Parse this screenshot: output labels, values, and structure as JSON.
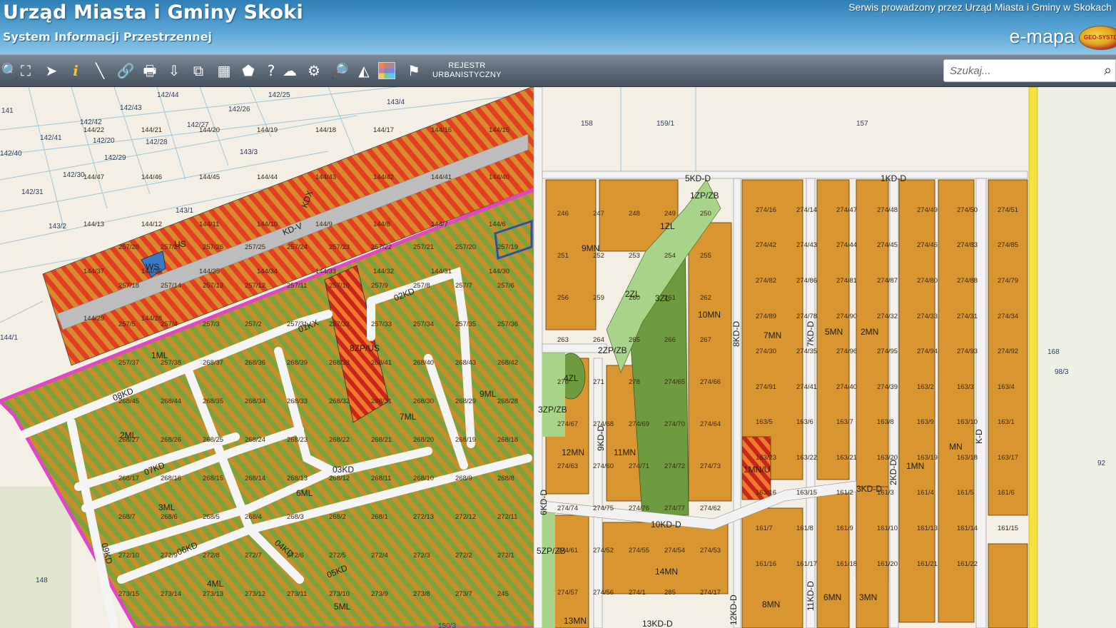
{
  "header": {
    "title": "Urząd Miasta i Gminy Skoki",
    "subtitle": "System Informacji Przestrzennej",
    "service_text": "Serwis prowadzony przez Urząd Miasta i Gminy w Skokach",
    "brand": "e-mapa",
    "logo_text": "GEO-SYSTEM"
  },
  "toolbar": {
    "tools": [
      {
        "icon": "zoom-in-icon",
        "glyph": "🔍"
      },
      {
        "icon": "zoom-extent-icon",
        "glyph": "⛶"
      },
      {
        "icon": "select-arrow-icon",
        "glyph": "➤"
      },
      {
        "icon": "info-icon",
        "glyph": "i"
      },
      {
        "icon": "measure-icon",
        "glyph": "╲"
      },
      {
        "icon": "link-icon",
        "glyph": "🔗"
      },
      {
        "icon": "print-icon",
        "glyph": "🖶"
      },
      {
        "icon": "download-icon",
        "glyph": "⇩"
      },
      {
        "icon": "copy-icon",
        "glyph": "⧉"
      },
      {
        "icon": "layout-icon",
        "glyph": "▦"
      },
      {
        "icon": "map-icon",
        "glyph": "⬟"
      },
      {
        "icon": "help-icon",
        "glyph": "?"
      },
      {
        "icon": "cloud-icon",
        "glyph": "☁"
      },
      {
        "icon": "settings-icon",
        "glyph": "⚙"
      },
      {
        "icon": "search-map-icon",
        "glyph": "🔎"
      },
      {
        "icon": "triangle-icon",
        "glyph": "◭"
      },
      {
        "icon": "layers-grid-icon",
        "glyph": ""
      },
      {
        "icon": "legend-icon",
        "glyph": "⚑"
      }
    ],
    "rejestr_line1": "REJESTR",
    "rejestr_line2": "URBANISTYCZNY"
  },
  "search": {
    "placeholder": "Szukaj..."
  },
  "colors": {
    "header": "#4a98cc",
    "toolbar": "#5d6b78",
    "residential": "#d9952f",
    "green_zone": "#7fa84b",
    "hatch_red": "#e24b2a",
    "plan_border": "#e246c4",
    "road": "#f1f1f1",
    "yellow_road": "#f5e23c"
  },
  "map": {
    "zone_labels": [
      "1ML",
      "2ML",
      "3ML",
      "4ML",
      "5ML",
      "6ML",
      "7ML",
      "9ML",
      "8ZP/US",
      "US",
      "WS",
      "9MN",
      "7MN",
      "5MN",
      "2MN",
      "10MN",
      "11MN",
      "12MN",
      "13MN",
      "14MN",
      "6MN",
      "3MN",
      "8MN",
      "1MN",
      "MN",
      "1MN/U",
      "1ZL",
      "2ZL",
      "3ZL",
      "4ZL",
      "1ZP/ZB",
      "2ZP/ZB",
      "3ZP/ZB",
      "5ZP/ZB"
    ],
    "road_labels": [
      "KD-V",
      "KDX",
      "1KD-D",
      "5KD-D",
      "10KD-D",
      "3KD-D",
      "9KD-D",
      "8KD-D",
      "7KD-D",
      "11KD-D",
      "12KD-D",
      "2KD-D",
      "K-D",
      "6KD-D",
      "13KD-D",
      "02KD",
      "03KD",
      "04KD",
      "05KD",
      "06KD",
      "07KD",
      "08KD",
      "09KD",
      "01KX"
    ],
    "parcel_labels": [
      "141",
      "142/44",
      "142/25",
      "142/43",
      "142/26",
      "142/42",
      "142/27",
      "142/41",
      "142/20",
      "142/28",
      "142/40",
      "142/29",
      "143/3",
      "143/4",
      "142/30",
      "142/31",
      "143/1",
      "143/2",
      "144/1",
      "158",
      "159/1",
      "157",
      "98/3",
      "168",
      "92",
      "148",
      "150/3"
    ],
    "plot_labels": [
      "144/22",
      "144/21",
      "144/20",
      "144/19",
      "144/18",
      "144/17",
      "144/16",
      "144/15",
      "144/47",
      "144/46",
      "144/45",
      "144/44",
      "144/43",
      "144/42",
      "144/41",
      "144/40",
      "144/13",
      "144/12",
      "144/11",
      "144/10",
      "144/9",
      "144/8",
      "144/7",
      "144/6",
      "144/37",
      "144/36",
      "144/35",
      "144/34",
      "144/33",
      "144/32",
      "144/31",
      "144/30",
      "144/29",
      "144/28",
      "257/28",
      "257/27",
      "257/26",
      "257/25",
      "257/24",
      "257/23",
      "257/22",
      "257/21",
      "257/20",
      "257/19",
      "257/18",
      "257/14",
      "257/13",
      "257/12",
      "257/11",
      "257/10",
      "257/9",
      "257/8",
      "257/7",
      "257/6",
      "257/5",
      "257/4",
      "257/3",
      "257/2",
      "257/31",
      "257/32",
      "257/33",
      "257/34",
      "257/35",
      "257/36",
      "257/37",
      "257/38",
      "268/37",
      "268/36",
      "268/39",
      "268/38",
      "268/41",
      "268/40",
      "268/43",
      "268/42",
      "268/45",
      "268/44",
      "268/35",
      "268/34",
      "268/33",
      "268/32",
      "268/31",
      "268/30",
      "268/29",
      "268/28",
      "268/27",
      "268/26",
      "268/25",
      "268/24",
      "268/23",
      "268/22",
      "268/21",
      "268/20",
      "268/19",
      "268/18",
      "268/17",
      "268/16",
      "268/15",
      "268/14",
      "268/13",
      "268/12",
      "268/11",
      "268/10",
      "268/9",
      "268/8",
      "268/7",
      "268/6",
      "268/5",
      "268/4",
      "268/3",
      "268/2",
      "268/1",
      "272/13",
      "272/12",
      "272/11",
      "272/10",
      "272/9",
      "272/8",
      "272/7",
      "272/6",
      "272/5",
      "272/4",
      "272/3",
      "272/2",
      "272/1",
      "273/15",
      "273/14",
      "273/13",
      "273/12",
      "273/11",
      "273/10",
      "273/9",
      "273/8",
      "273/7",
      "245",
      "246",
      "247",
      "248",
      "249",
      "250",
      "251",
      "252",
      "253",
      "254",
      "255",
      "256",
      "259",
      "260",
      "261",
      "262",
      "263",
      "264",
      "265",
      "266",
      "267",
      "270",
      "271",
      "278",
      "274/65",
      "274/66",
      "274/67",
      "274/68",
      "274/69",
      "274/70",
      "274/64",
      "274/63",
      "274/60",
      "274/71",
      "274/72",
      "274/73",
      "274/74",
      "274/75",
      "274/76",
      "274/77",
      "274/62",
      "274/61",
      "274/52",
      "274/55",
      "274/54",
      "274/53",
      "274/57",
      "274/56",
      "274/1",
      "285",
      "274/17",
      "274/16",
      "274/14",
      "274/47",
      "274/48",
      "274/49",
      "274/50",
      "274/51",
      "274/42",
      "274/43",
      "274/44",
      "274/45",
      "274/46",
      "274/83",
      "274/85",
      "274/82",
      "274/86",
      "274/81",
      "274/87",
      "274/80",
      "274/88",
      "274/79",
      "274/89",
      "274/78",
      "274/90",
      "274/32",
      "274/33",
      "274/31",
      "274/34",
      "274/30",
      "274/35",
      "274/96",
      "274/95",
      "274/94",
      "274/93",
      "274/92",
      "274/91",
      "274/41",
      "274/40",
      "274/39",
      "163/2",
      "163/3",
      "163/4",
      "163/5",
      "163/6",
      "163/7",
      "163/8",
      "163/9",
      "163/10",
      "163/1",
      "163/23",
      "163/22",
      "163/21",
      "163/20",
      "163/19",
      "163/18",
      "163/17",
      "163/16",
      "163/15",
      "161/2",
      "161/3",
      "161/4",
      "161/5",
      "161/6",
      "161/7",
      "161/8",
      "161/9",
      "161/10",
      "161/13",
      "161/14",
      "161/15",
      "161/16",
      "161/17",
      "161/18",
      "161/20",
      "161/21",
      "161/22"
    ]
  }
}
